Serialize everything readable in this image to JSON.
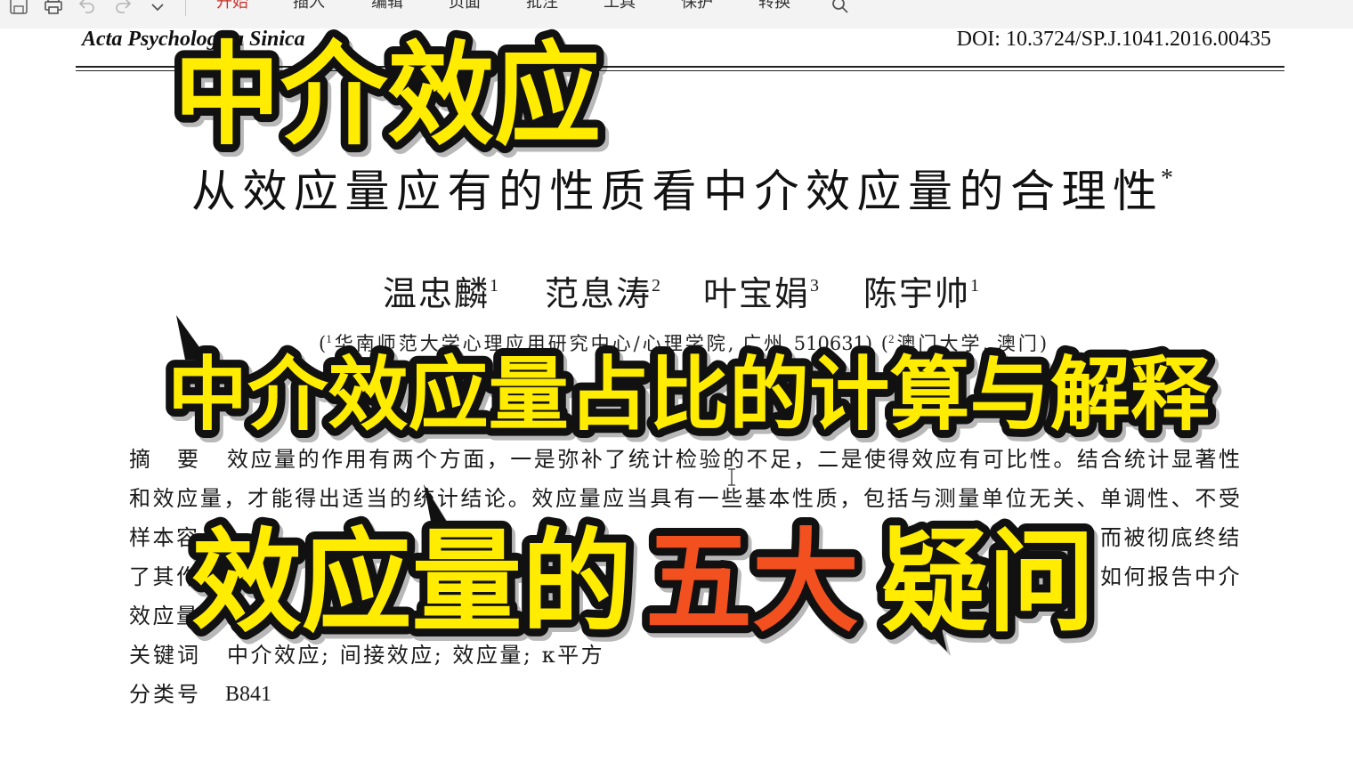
{
  "toolbar": {
    "icons": [
      "save-icon",
      "print-icon",
      "undo-icon",
      "redo-icon",
      "chevron-down-icon",
      "search-icon"
    ],
    "accent": "#c8302a",
    "tabs": [
      {
        "label": "开始",
        "active": true
      },
      {
        "label": "插入",
        "active": false
      },
      {
        "label": "编辑",
        "active": false
      },
      {
        "label": "页面",
        "active": false
      },
      {
        "label": "批注",
        "active": false
      },
      {
        "label": "工具",
        "active": false
      },
      {
        "label": "保护",
        "active": false
      },
      {
        "label": "转换",
        "active": false
      }
    ]
  },
  "document": {
    "journal": "Acta Psychologica Sinica",
    "doi": "DOI: 10.3724/SP.J.1041.2016.00435",
    "title": "从效应量应有的性质看中介效应量的合理性",
    "title_mark": "*",
    "authors": [
      {
        "name": "温忠麟",
        "sup": "1"
      },
      {
        "name": "范息涛",
        "sup": "2"
      },
      {
        "name": "叶宝娟",
        "sup": "3"
      },
      {
        "name": "陈宇帅",
        "sup": "1"
      }
    ],
    "affiliation": {
      "open": "(",
      "sup1": "1",
      "text1": "华南师范大学心理应用研究中心/心理学院, 广州 510631) (",
      "sup2": "2",
      "text2": "澳门大学, 澳门)"
    },
    "abstract": {
      "label": "摘　要",
      "line1": "效应量的作用有两个方面，一是弥补了统计检验的不足，二是使得效应有可比性。结合统计显著性",
      "line2": "和效应量，才能得出适当的统计结论。效应量应当具有一些基本性质，包括与测量单位无关、单调性、不受",
      "line3": {
        "left": "样本容",
        "right": "而被彻底终结"
      },
      "line4": {
        "left": "了其作",
        "right": "如何报告中介"
      },
      "line5": {
        "left": "效应量"
      }
    },
    "keywords": {
      "label": "关键词",
      "value": "中介效应; 间接效应; 效应量; κ平方"
    },
    "classification": {
      "label": "分类号",
      "value": "B841"
    }
  },
  "overlays": {
    "headline_1": "中介效应",
    "headline_2": "中介效应量占比的计算与解释",
    "headline_3": {
      "part1": "效应量的",
      "part2": "五大",
      "part3": "疑问"
    },
    "colors": {
      "fill": "#ffec00",
      "highlight": "#f2501f",
      "outline": "#111111"
    }
  }
}
